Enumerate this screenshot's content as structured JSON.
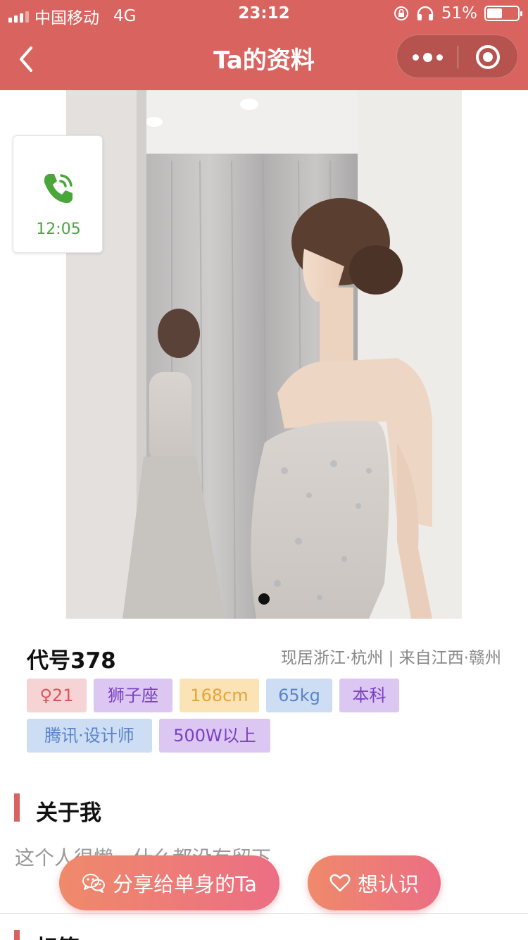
{
  "status_bar": {
    "carrier": "中国移动",
    "network": "4G",
    "time": "23:12",
    "battery": "51%",
    "battery_level": 0.51
  },
  "nav": {
    "title": "Ta的资料",
    "back_icon": "chevron-left-icon",
    "more_icon": "more-dots-icon",
    "close_icon": "target-circle-icon"
  },
  "call_card": {
    "icon": "phone-ringing-icon",
    "duration": "12:05"
  },
  "profile": {
    "codename": "代号378",
    "location": "现居浙江·杭州 | 来自江西·赣州",
    "tags": [
      {
        "label": "♀21",
        "style": "pink"
      },
      {
        "label": "狮子座",
        "style": "purple"
      },
      {
        "label": "168cm",
        "style": "yellow"
      },
      {
        "label": "65kg",
        "style": "blue"
      },
      {
        "label": "本科",
        "style": "purple"
      },
      {
        "label": "腾讯·设计师",
        "style": "blue"
      },
      {
        "label": "500W以上",
        "style": "purple"
      }
    ]
  },
  "about": {
    "title": "关于我",
    "text": "这个人很懒，什么都没有留下"
  },
  "next_section": {
    "title": "标签"
  },
  "actions": {
    "share_label": "分享给单身的Ta",
    "share_icon": "wechat-icon",
    "meet_label": "想认识",
    "meet_icon": "heart-outline-icon"
  },
  "colors": {
    "brand": "#d9635f",
    "button_gradient_start": "#ef8a6a",
    "button_gradient_end": "#ec6e84",
    "call_green": "#4aa63b"
  }
}
